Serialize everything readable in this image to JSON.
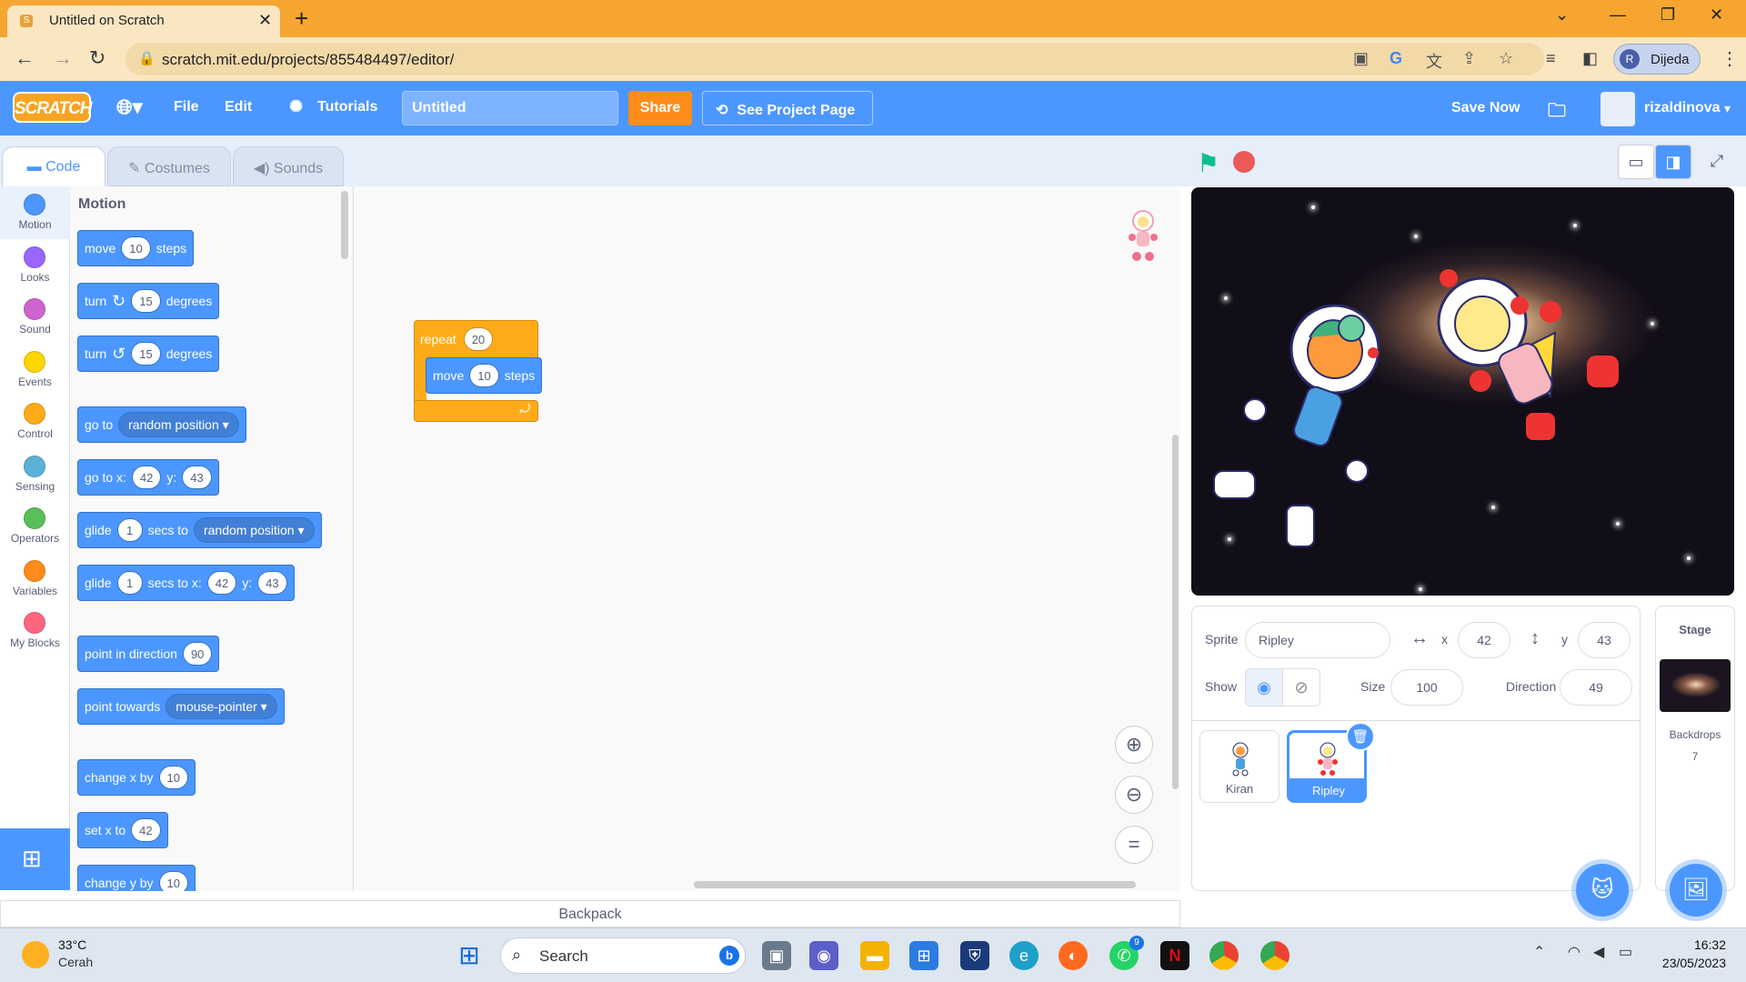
{
  "browser": {
    "tab_title": "Untitled on Scratch",
    "url": "scratch.mit.edu/projects/855484497/editor/",
    "profile_initial": "R",
    "profile_name": "Dijeda"
  },
  "menu": {
    "logo": "SCRATCH",
    "file": "File",
    "edit": "Edit",
    "tutorials": "Tutorials",
    "project_title": "Untitled",
    "share": "Share",
    "see_project": "See Project Page",
    "save_now": "Save Now",
    "username": "rizaldinova"
  },
  "tabs": {
    "code": "Code",
    "costumes": "Costumes",
    "sounds": "Sounds"
  },
  "categories": [
    {
      "label": "Motion",
      "color": "#4c97ff"
    },
    {
      "label": "Looks",
      "color": "#9966ff"
    },
    {
      "label": "Sound",
      "color": "#cf63cf"
    },
    {
      "label": "Events",
      "color": "#ffd500"
    },
    {
      "label": "Control",
      "color": "#ffab19"
    },
    {
      "label": "Sensing",
      "color": "#5cb1d6"
    },
    {
      "label": "Operators",
      "color": "#59c059"
    },
    {
      "label": "Variables",
      "color": "#ff8c1a"
    },
    {
      "label": "My Blocks",
      "color": "#ff6680"
    }
  ],
  "palette": {
    "heading": "Motion",
    "b1": {
      "a": "move",
      "v": "10",
      "b": "steps"
    },
    "b2": {
      "a": "turn",
      "icon": "↻",
      "v": "15",
      "b": "degrees"
    },
    "b3": {
      "a": "turn",
      "icon": "↺",
      "v": "15",
      "b": "degrees"
    },
    "b4": {
      "a": "go to",
      "dd": "random position"
    },
    "b5": {
      "a": "go to x:",
      "x": "42",
      "b": "y:",
      "y": "43"
    },
    "b6": {
      "a": "glide",
      "v": "1",
      "b": "secs to",
      "dd": "random position"
    },
    "b7": {
      "a": "glide",
      "v": "1",
      "b": "secs to x:",
      "x": "42",
      "c": "y:",
      "y": "43"
    },
    "b8": {
      "a": "point in direction",
      "v": "90"
    },
    "b9": {
      "a": "point towards",
      "dd": "mouse-pointer"
    },
    "b10": {
      "a": "change x by",
      "v": "10"
    },
    "b11": {
      "a": "set x to",
      "v": "42"
    },
    "b12": {
      "a": "change y by",
      "v": "10"
    }
  },
  "script": {
    "repeat_label": "repeat",
    "repeat_count": "20",
    "move_label": "move",
    "move_steps": "10",
    "steps_label": "steps",
    "loop_arrow": "⤾"
  },
  "backpack": "Backpack",
  "sprite": {
    "label": "Sprite",
    "name": "Ripley",
    "x_label": "x",
    "x": "42",
    "y_label": "y",
    "y": "43",
    "show_label": "Show",
    "size_label": "Size",
    "size": "100",
    "direction_label": "Direction",
    "direction": "49"
  },
  "sprites": [
    {
      "name": "Kiran"
    },
    {
      "name": "Ripley"
    }
  ],
  "stage_pane": {
    "title": "Stage",
    "backdrops_label": "Backdrops",
    "backdrops_count": "7"
  },
  "taskbar": {
    "temp": "33°C",
    "weather": "Cerah",
    "search": "Search",
    "time": "16:32",
    "date": "23/05/2023",
    "whatsapp_badge": "9"
  }
}
